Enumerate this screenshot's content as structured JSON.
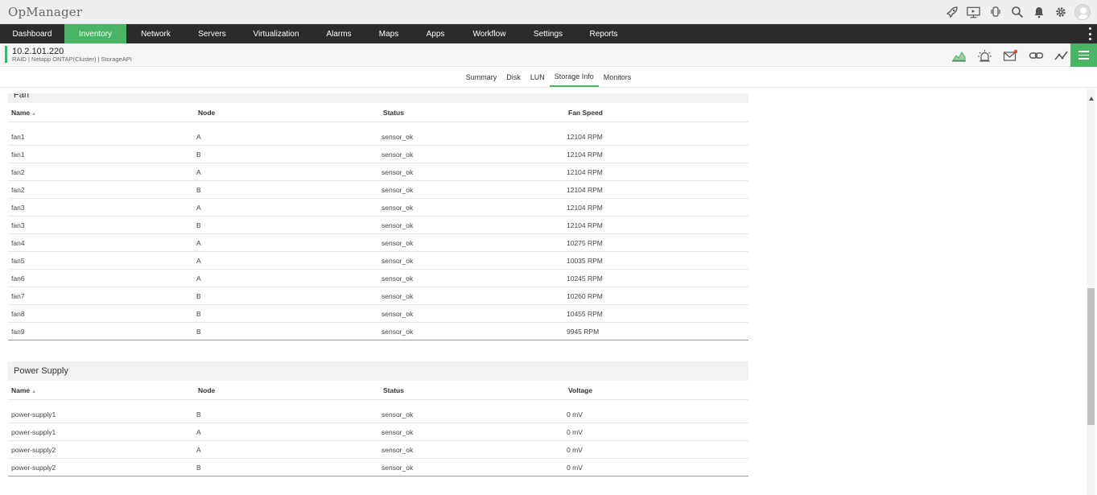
{
  "app": {
    "title": "OpManager"
  },
  "top_icons": [
    "rocket-icon",
    "presentation-icon",
    "hand-icon",
    "search-icon",
    "bell-icon",
    "gear-icon",
    "user-avatar-icon"
  ],
  "nav": {
    "items": [
      {
        "label": "Dashboard",
        "active": false
      },
      {
        "label": "Inventory",
        "active": true
      },
      {
        "label": "Network",
        "active": false
      },
      {
        "label": "Servers",
        "active": false
      },
      {
        "label": "Virtualization",
        "active": false
      },
      {
        "label": "Alarms",
        "active": false
      },
      {
        "label": "Maps",
        "active": false
      },
      {
        "label": "Apps",
        "active": false
      },
      {
        "label": "Workflow",
        "active": false
      },
      {
        "label": "Settings",
        "active": false
      },
      {
        "label": "Reports",
        "active": false
      }
    ]
  },
  "device": {
    "ip": "10.2.101.220",
    "meta": "RAID | Netapp ONTAP(Cluster)  | StorageAPI",
    "icons": [
      "graph-icon",
      "alarm-light-icon",
      "mail-icon",
      "link-icon",
      "monitor-line-icon",
      "menu-icon"
    ]
  },
  "tabs": [
    {
      "label": "Summary",
      "active": false
    },
    {
      "label": "Disk",
      "active": false
    },
    {
      "label": "LUN",
      "active": false
    },
    {
      "label": "Storage Info",
      "active": true
    },
    {
      "label": "Monitors",
      "active": false
    }
  ],
  "fan": {
    "title": "Fan",
    "columns": [
      "Name",
      "Node",
      "Status",
      "Fan Speed"
    ],
    "rows": [
      [
        "fan1",
        "A",
        "sensor_ok",
        "12104 RPM"
      ],
      [
        "fan1",
        "B",
        "sensor_ok",
        "12104 RPM"
      ],
      [
        "fan2",
        "A",
        "sensor_ok",
        "12104 RPM"
      ],
      [
        "fan2",
        "B",
        "sensor_ok",
        "12104 RPM"
      ],
      [
        "fan3",
        "A",
        "sensor_ok",
        "12104 RPM"
      ],
      [
        "fan3",
        "B",
        "sensor_ok",
        "12104 RPM"
      ],
      [
        "fan4",
        "A",
        "sensor_ok",
        "10275 RPM"
      ],
      [
        "fan5",
        "A",
        "sensor_ok",
        "10035 RPM"
      ],
      [
        "fan6",
        "A",
        "sensor_ok",
        "10245 RPM"
      ],
      [
        "fan7",
        "B",
        "sensor_ok",
        "10260 RPM"
      ],
      [
        "fan8",
        "B",
        "sensor_ok",
        "10455 RPM"
      ],
      [
        "fan9",
        "B",
        "sensor_ok",
        "9945 RPM"
      ]
    ]
  },
  "power": {
    "title": "Power Supply",
    "columns": [
      "Name",
      "Node",
      "Status",
      "Voltage"
    ],
    "rows": [
      [
        "power-supply1",
        "B",
        "sensor_ok",
        "0 mV"
      ],
      [
        "power-supply1",
        "A",
        "sensor_ok",
        "0 mV"
      ],
      [
        "power-supply2",
        "A",
        "sensor_ok",
        "0 mV"
      ],
      [
        "power-supply2",
        "B",
        "sensor_ok",
        "0 mV"
      ]
    ]
  },
  "colors": {
    "accent": "#49b463",
    "navbar": "#2b2b2b",
    "topbar": "#efefef"
  }
}
